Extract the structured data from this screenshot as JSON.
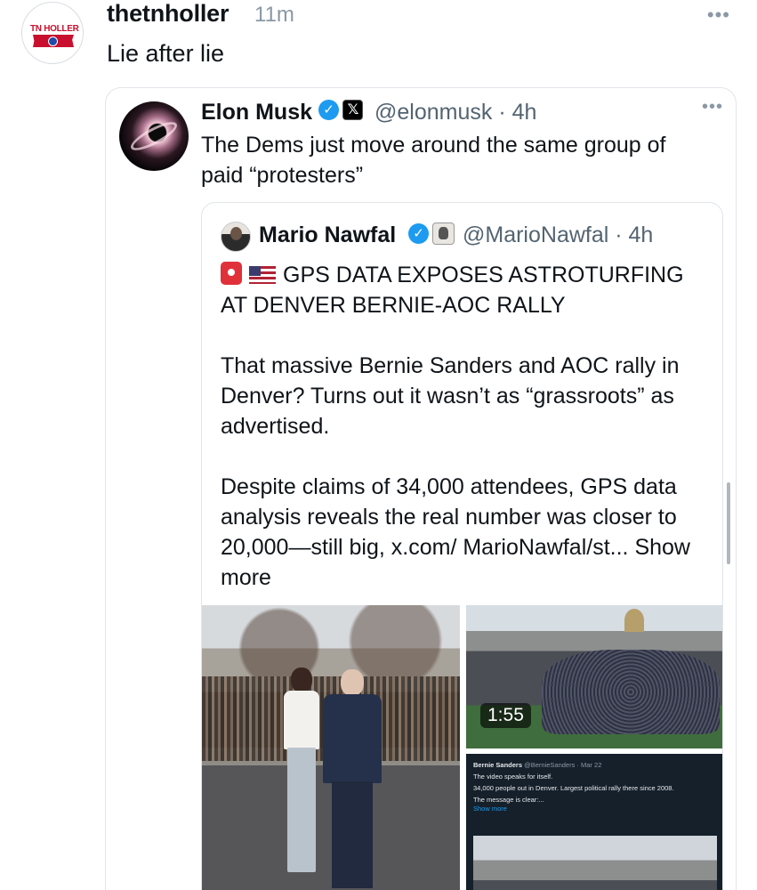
{
  "post": {
    "avatar_text": "TN HOLLER",
    "username": "thetnholler",
    "time": "11m",
    "more": "•••",
    "text": "Lie after lie"
  },
  "quote": {
    "name": "Elon Musk",
    "handle": "@elonmusk · 4h",
    "more": "•••",
    "verified_glyph": "✓",
    "x_glyph": "𝕏",
    "text": "The Dems just move around the same group of paid “protesters”"
  },
  "inner_quote": {
    "name": "Mario Nawfal",
    "handle": "@MarioNawfal · 4h",
    "verified_glyph": "✓",
    "headline": "GPS DATA EXPOSES ASTROTURFING AT DENVER BERNIE-AOC RALLY",
    "para1": "That massive Bernie Sanders and AOC rally in Denver? Turns out it wasn’t as “grassroots” as advertised.",
    "para2": "Despite claims of 34,000 attendees, GPS data analysis reveals the real number was closer to 20,000—still big, x.com/ MarioNawfal/st... Show more",
    "video_duration": "1:55",
    "embedded_tweet": {
      "name": "Bernie Sanders",
      "handle": "@BernieSanders · Mar 22",
      "line1": "The video speaks for itself.",
      "line2": "34,000 people out in Denver. Largest political rally there since 2008.",
      "line3": "The message is clear:...",
      "show_more": "Show more"
    }
  },
  "colors": {
    "verified": "#1d9bf0",
    "secondary_text": "#536471",
    "border": "#e1e5e9"
  }
}
